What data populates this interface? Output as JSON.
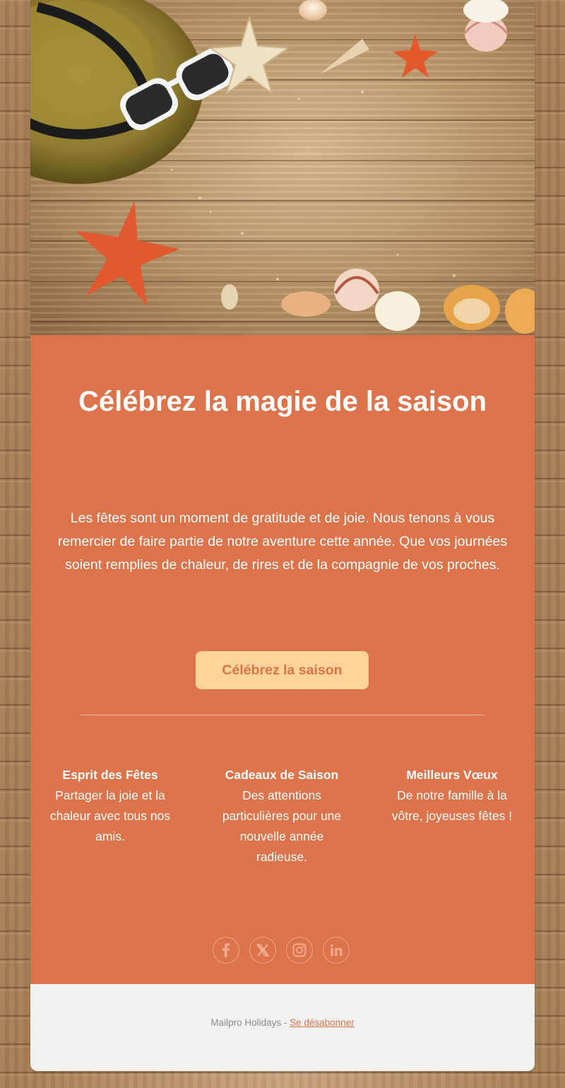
{
  "hero": {
    "image_description_icon": "beach-flatlay-illustration"
  },
  "headline": "Célébrez la magie de la saison",
  "intro": "Les fêtes sont un moment de gratitude et de joie. Nous tenons à vous remercier de faire partie de notre aventure cette année. Que vos journées soient remplies de chaleur, de rires et de la compagnie de vos proches.",
  "cta": {
    "label": "Célébrez la saison"
  },
  "columns": [
    {
      "heading": "Esprit des Fêtes",
      "text": "Partager la joie et la chaleur avec tous nos amis."
    },
    {
      "heading": "Cadeaux de Saison",
      "text": "Des attentions particulières pour une nouvelle année radieuse."
    },
    {
      "heading": "Meilleurs Vœux",
      "text": "De notre famille à la vôtre, joyeuses fêtes !"
    }
  ],
  "socials": [
    {
      "icon": "facebook-icon"
    },
    {
      "icon": "x-icon"
    },
    {
      "icon": "instagram-icon"
    },
    {
      "icon": "linkedin-icon"
    }
  ],
  "footer": {
    "brand": "Mailpro Holidays",
    "separator": " - ",
    "unsubscribe": "Se désabonner"
  },
  "colors": {
    "accent": "#dc734b",
    "button": "#ffd39a",
    "footer_bg": "#f1f1f1"
  }
}
